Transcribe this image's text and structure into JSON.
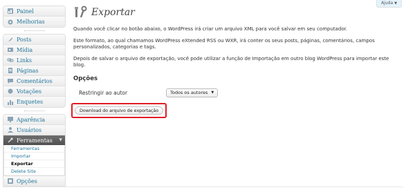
{
  "help": {
    "label": "Ajuda"
  },
  "sidebar": {
    "top": [
      {
        "label": "Painel"
      },
      {
        "label": "Melhorias"
      }
    ],
    "middle": [
      {
        "label": "Posts"
      },
      {
        "label": "Mídia"
      },
      {
        "label": "Links"
      },
      {
        "label": "Páginas"
      },
      {
        "label": "Comentários"
      },
      {
        "label": "Votações"
      },
      {
        "label": "Enquetes"
      }
    ],
    "bottom": [
      {
        "label": "Aparência"
      },
      {
        "label": "Usuários"
      }
    ],
    "tools": {
      "label": "Ferramentas",
      "submenu": [
        {
          "label": "Ferramentas"
        },
        {
          "label": "Importar"
        },
        {
          "label": "Exportar"
        },
        {
          "label": "Delete Site"
        }
      ]
    },
    "options": {
      "label": "Opções"
    }
  },
  "main": {
    "title": "Exportar",
    "paragraphs": [
      "Quando você clicar no botão abaixo, o WordPress irá criar um arquivo XML para você salvar em seu computador.",
      "Este formato, ao qual chamamos WordPress eXtended RSS ou WXR, irá conter os seus posts, páginas, comentários, campos personalizados, categorias e tags.",
      "Depois de salvar o arquivo de exportação, você pode utilizar a função de Importação em outro blog WordPress para importar este blog."
    ],
    "options_heading": "Opções",
    "restrict_label": "Restringir ao autor",
    "author_select": "Todos os autores",
    "download_button": "Download do arquivo de exportação"
  },
  "colors": {
    "link": "#21759b",
    "highlight": "#e21b23"
  }
}
